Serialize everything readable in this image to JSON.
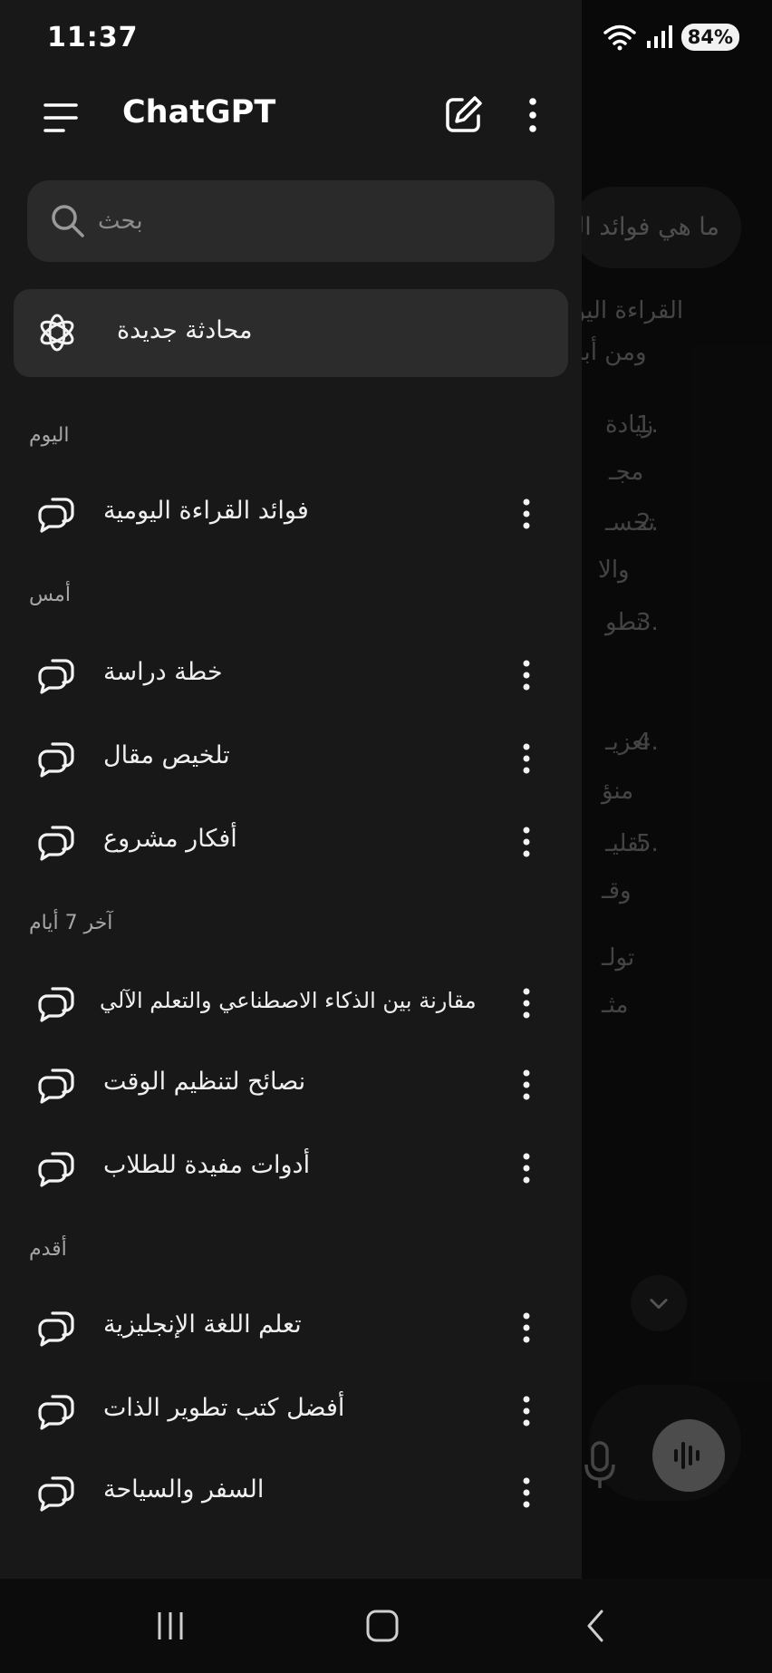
{
  "status_bar": {
    "time": "11:37",
    "battery": "84%"
  },
  "drawer": {
    "title": "ChatGPT",
    "search": {
      "placeholder": "بحث"
    },
    "new_chat_label": "محادثة جديدة",
    "sections": {
      "today": {
        "label": "اليوم",
        "items": [
          "فوائد القراءة اليومية"
        ]
      },
      "yesterday": {
        "label": "أمس",
        "items": [
          "خطة دراسة",
          "تلخيص مقال",
          "أفكار مشروع"
        ]
      },
      "last7": {
        "label": "آخر 7 أيام",
        "items": [
          "مقارنة بين الذكاء الاصطناعي والتعلم الآلي",
          "نصائح لتنظيم الوقت",
          "أدوات مفيدة للطلاب"
        ]
      },
      "older": {
        "label": "أقدم",
        "items": [
          "تعلم اللغة الإنجليزية",
          "أفضل كتب تطوير الذات",
          "السفر والسياحة"
        ]
      }
    }
  },
  "background_chat": {
    "user_message": "ما هي فوائد القراءة اليومية",
    "fragments": [
      "القراءة اليومية",
      "ومن أبرزها",
      "زيادة",
      "مجـ",
      "تحسـ",
      "والا",
      "تطو",
      "تعزيـ",
      "منؤ",
      "تقليـ",
      "وقـ",
      "تولـ",
      "مثـ"
    ],
    "numbers": [
      "1.",
      "2.",
      "3.",
      "4.",
      "5."
    ]
  },
  "colors": {
    "drawer_bg": "#181818",
    "accent": "#ffffff",
    "muted": "#a6a6a6"
  }
}
